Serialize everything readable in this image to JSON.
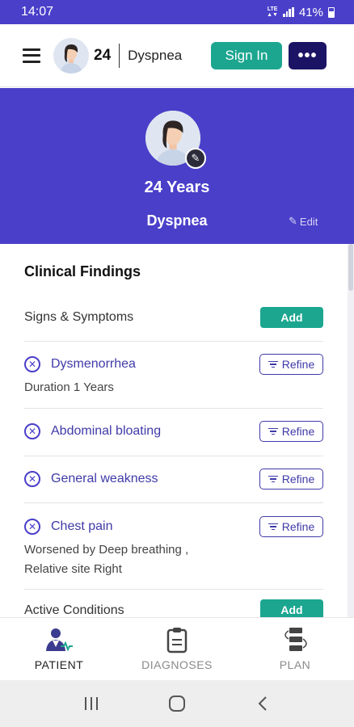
{
  "status_bar": {
    "time": "14:07",
    "network": "LTE",
    "battery": "41%"
  },
  "header": {
    "age": "24",
    "complaint": "Dyspnea",
    "signin_label": "Sign In",
    "more_label": "•••"
  },
  "banner": {
    "age_label": "24 Years",
    "complaint": "Dyspnea",
    "edit_label": "Edit"
  },
  "clinical": {
    "title": "Clinical Findings",
    "signs_label": "Signs & Symptoms",
    "add_label": "Add",
    "refine_label": "Refine",
    "findings": [
      {
        "name": "Dysmenorrhea",
        "details": [
          "Duration 1 Years"
        ]
      },
      {
        "name": "Abdominal bloating",
        "details": []
      },
      {
        "name": "General weakness",
        "details": []
      },
      {
        "name": "Chest pain",
        "details": [
          "Worsened by Deep breathing ,",
          "Relative site Right"
        ]
      }
    ],
    "active_conditions_label": "Active Conditions"
  },
  "bottom_nav": {
    "items": [
      {
        "label": "PATIENT"
      },
      {
        "label": "DIAGNOSES"
      },
      {
        "label": "PLAN"
      }
    ]
  },
  "colors": {
    "brand": "#4a3fc9",
    "accent_green": "#1ca690",
    "dark_navy": "#1b1465",
    "link_purple": "#3f3aa8"
  }
}
